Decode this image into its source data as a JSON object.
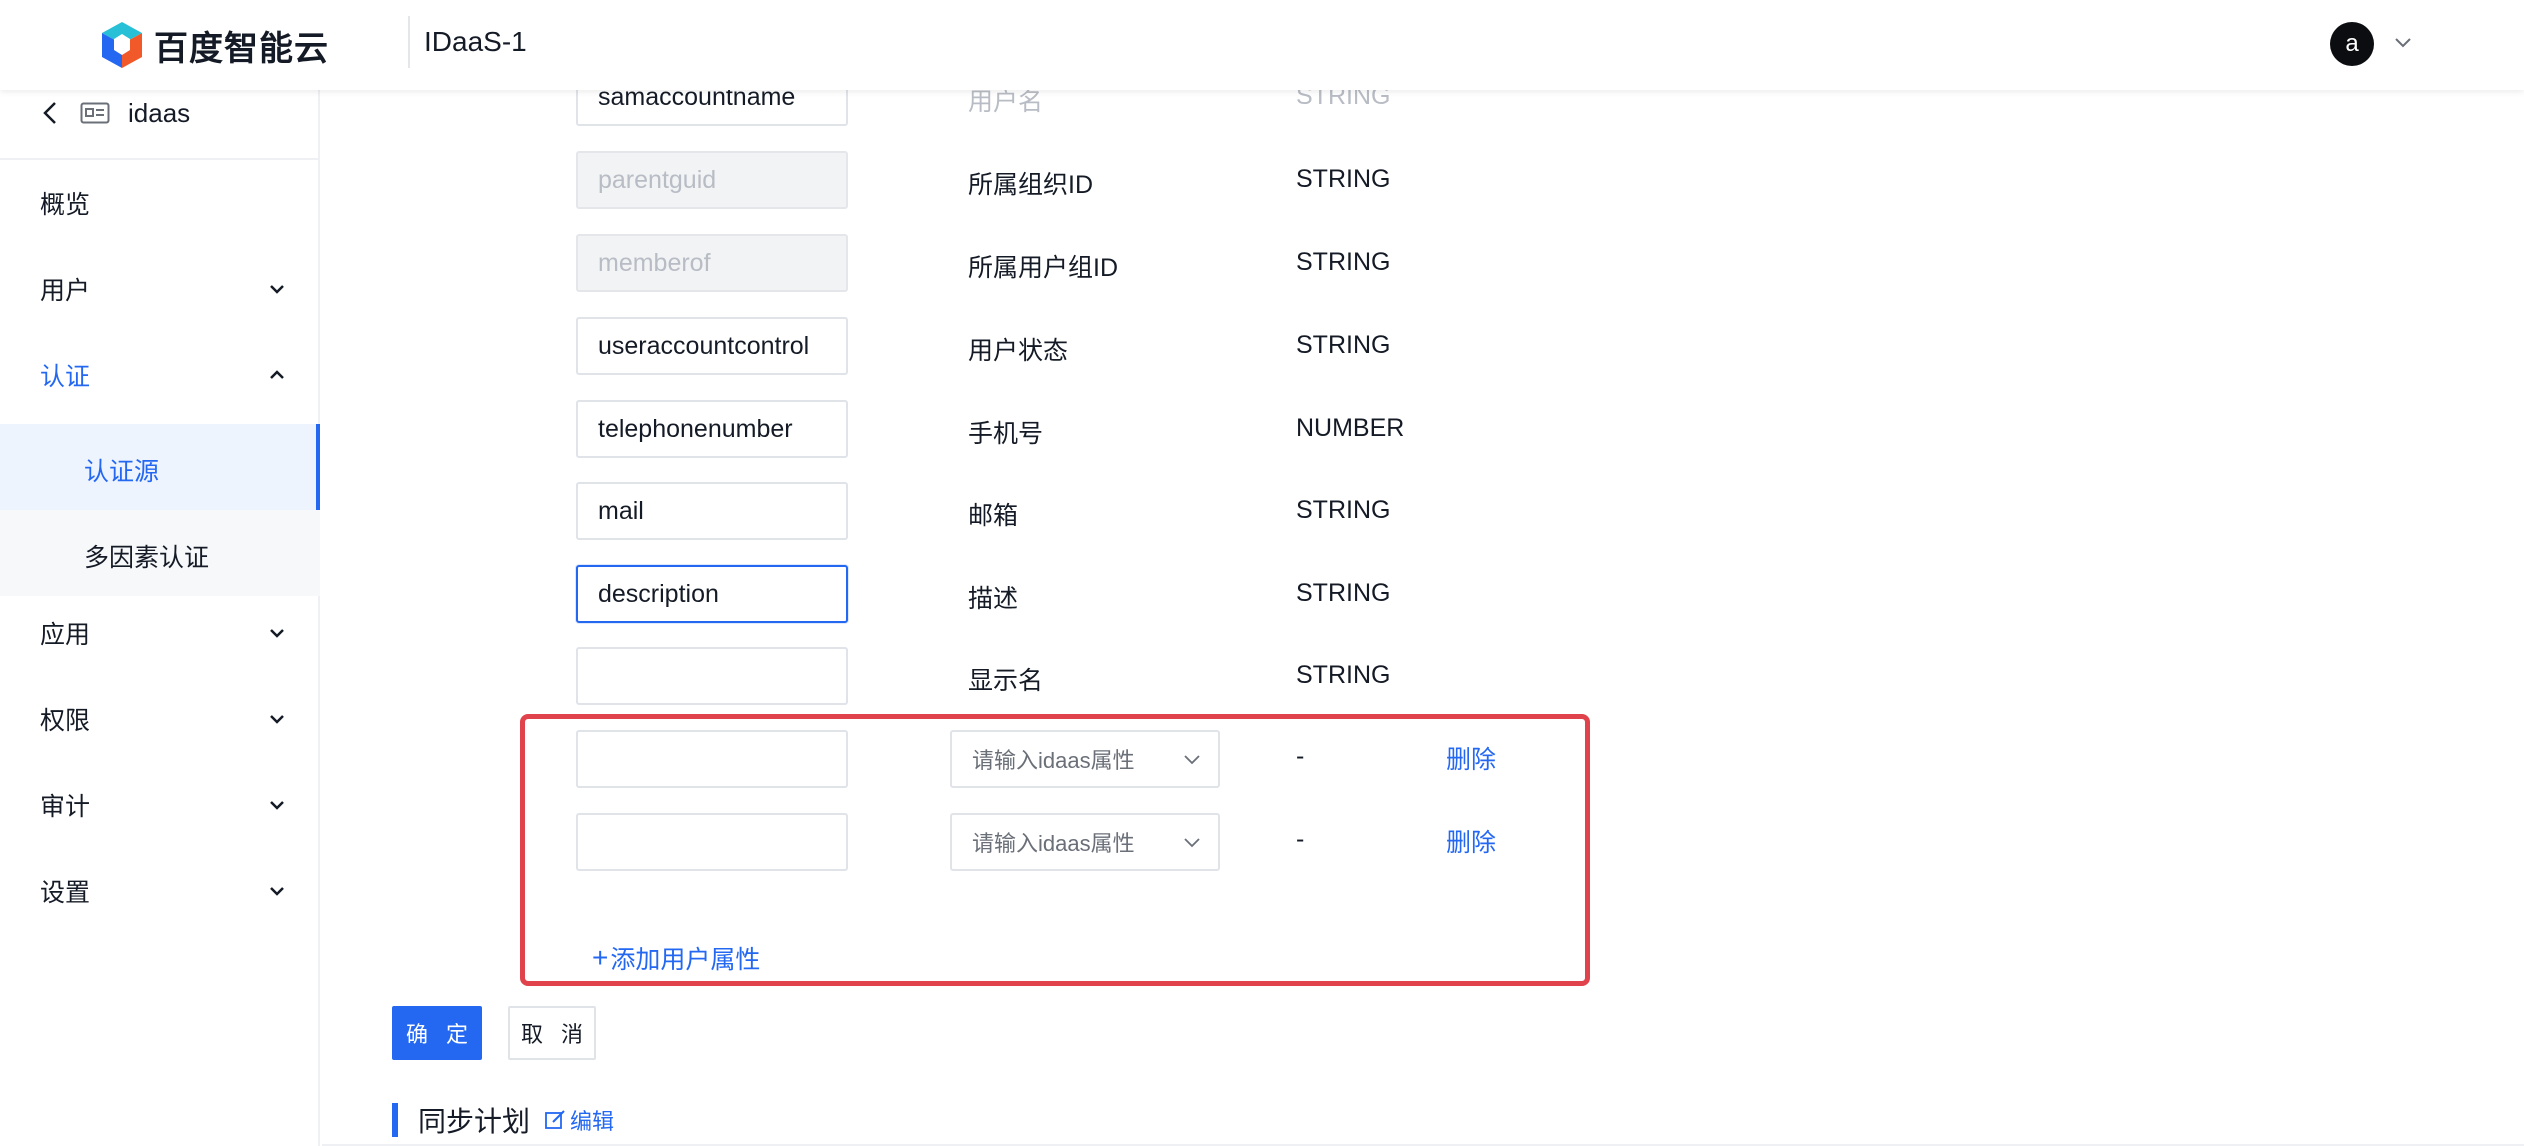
{
  "header": {
    "brand": "百度智能云",
    "product": "IDaaS-1",
    "avatar_letter": "a"
  },
  "sidebar": {
    "back_title": "idaas",
    "items": [
      {
        "label": "概览"
      },
      {
        "label": "用户"
      },
      {
        "label": "认证"
      },
      {
        "label": "认证源"
      },
      {
        "label": "多因素认证"
      },
      {
        "label": "应用"
      },
      {
        "label": "权限"
      },
      {
        "label": "审计"
      },
      {
        "label": "设置"
      }
    ]
  },
  "mapping": {
    "rows": [
      {
        "field": "samaccountname",
        "attr": "用户名",
        "type": "STRING"
      },
      {
        "field": "parentguid",
        "attr": "所属组织ID",
        "type": "STRING"
      },
      {
        "field": "memberof",
        "attr": "所属用户组ID",
        "type": "STRING"
      },
      {
        "field": "useraccountcontrol",
        "attr": "用户状态",
        "type": "STRING"
      },
      {
        "field": "telephonenumber",
        "attr": "手机号",
        "type": "NUMBER"
      },
      {
        "field": "mail",
        "attr": "邮箱",
        "type": "STRING"
      },
      {
        "field": "description",
        "attr": "描述",
        "type": "STRING"
      },
      {
        "field": "",
        "attr": "显示名",
        "type": "STRING"
      }
    ],
    "custom_rows": [
      {
        "field": "",
        "select_placeholder": "请输入idaas属性",
        "type": "-",
        "delete_label": "删除"
      },
      {
        "field": "",
        "select_placeholder": "请输入idaas属性",
        "type": "-",
        "delete_label": "删除"
      }
    ],
    "add_label": "添加用户属性"
  },
  "actions": {
    "confirm": "确 定",
    "cancel": "取 消"
  },
  "sync_section": {
    "title": "同步计划",
    "edit_label": "编辑"
  },
  "colors": {
    "accent": "#2468f2",
    "highlight": "#e0434b"
  }
}
